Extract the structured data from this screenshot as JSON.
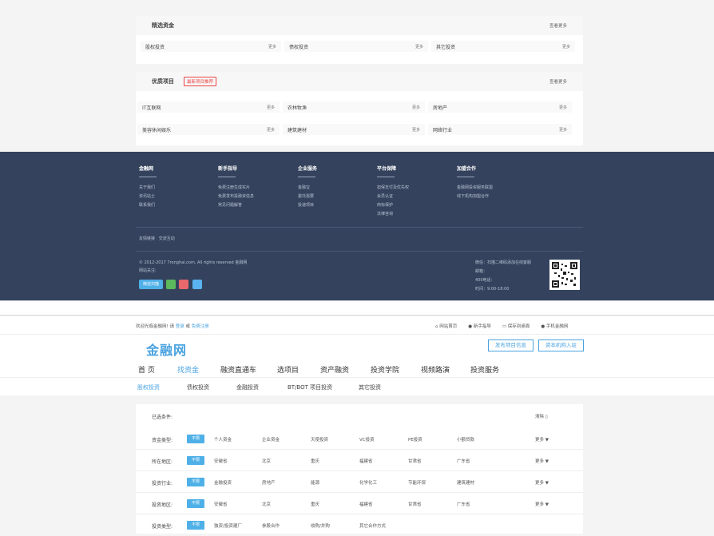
{
  "panels": [
    {
      "title": "精选资金",
      "more": "查看更多",
      "cells": [
        {
          "name": "股权投资",
          "more": "更多"
        },
        {
          "name": "债权投资",
          "more": "更多"
        },
        {
          "name": "其它投资",
          "more": "更多"
        }
      ]
    },
    {
      "title": "优质项目",
      "badge": "最新项目推荐",
      "more": "查看更多",
      "cells": [
        {
          "name": "IT互联网",
          "more": "更多"
        },
        {
          "name": "农林牧渔",
          "more": "更多"
        },
        {
          "name": "房地产",
          "more": "更多"
        },
        {
          "name": "美容休闲娱乐",
          "more": "更多"
        },
        {
          "name": "建筑建材",
          "more": "更多"
        },
        {
          "name": "网络行业",
          "more": "更多"
        }
      ]
    }
  ],
  "footer": {
    "columns": [
      {
        "title": "金融网",
        "links": [
          "关于我们",
          "资讯站士",
          "联系我们"
        ]
      },
      {
        "title": "新手指导",
        "links": [
          "免费注册生成实片",
          "免费发布投融资信息",
          "常见问题解答"
        ]
      },
      {
        "title": "企业服务",
        "links": [
          "金融宝",
          "委托需要",
          "投递项目"
        ]
      },
      {
        "title": "平台保障",
        "links": [
          "担保支付及优先权",
          "会员认证",
          "商标保护",
          "法律咨询"
        ]
      },
      {
        "title": "加盟合作",
        "links": [
          "金融网投资服务联盟",
          "线下机构加盟合作"
        ]
      }
    ],
    "friend_links": [
      "友情链接",
      "交流互动"
    ],
    "copyright": "© 2012-2017 7ronghai.com. All rights reserved 金融网",
    "share_label": "网站关注:",
    "share_button": "微信扫描",
    "contact": [
      "微信：扫描二维码添加在线客服",
      "邮箱：",
      "400电话：",
      "时间：9:00-18:00"
    ]
  },
  "topbar": {
    "welcome": "欢迎光临金融网! 请",
    "login": "登录",
    "or": "或",
    "register": "免费注册",
    "links": [
      "网站首页",
      "新手指导",
      "保存到桌面",
      "手机金融网"
    ]
  },
  "header": {
    "logo": "金融网",
    "btn_publish": "发布项目信息",
    "btn_join": "资本机构入驻",
    "nav": [
      "首 页",
      "找资金",
      "融资直通车",
      "选项目",
      "资产融资",
      "投资学院",
      "视频路演",
      "投资服务"
    ],
    "active_nav": 1,
    "subnav": [
      "股权投资",
      "债权投资",
      "金融投资",
      "BT/BOT 项目投资",
      "其它投资"
    ],
    "active_subnav": 0
  },
  "filter": {
    "selected_label": "已选条件:",
    "clear": "清除",
    "rows": [
      {
        "label": "资金类型:",
        "tag": "不限",
        "options": [
          "个人资金",
          "企业资金",
          "天使投资",
          "VC投资",
          "PE投资",
          "小额贷款"
        ],
        "more": "更多"
      },
      {
        "label": "所在地区:",
        "tag": "不限",
        "options": [
          "安徽省",
          "北京",
          "重庆",
          "福建省",
          "甘肃省",
          "广东省"
        ],
        "more": "更多"
      },
      {
        "label": "投资行业:",
        "tag": "不限",
        "options": [
          "金融投资",
          "房地产",
          "能源",
          "化学化工",
          "节能环保",
          "建筑建材"
        ],
        "more": "更多"
      },
      {
        "label": "投资地区:",
        "tag": "不限",
        "options": [
          "安徽省",
          "北京",
          "重庆",
          "福建省",
          "甘肃省",
          "广东省"
        ],
        "more": "更多"
      },
      {
        "label": "投资类型:",
        "tag": "不限",
        "options": [
          "独资/投资建厂",
          "参股合作",
          "收购/并购",
          "其它合作方式"
        ],
        "more": ""
      }
    ]
  },
  "colors": {
    "accent": "#4aa3e0",
    "footer_bg": "#34425d",
    "tag_bg": "#4fb0e8",
    "badge": "#e44444"
  }
}
